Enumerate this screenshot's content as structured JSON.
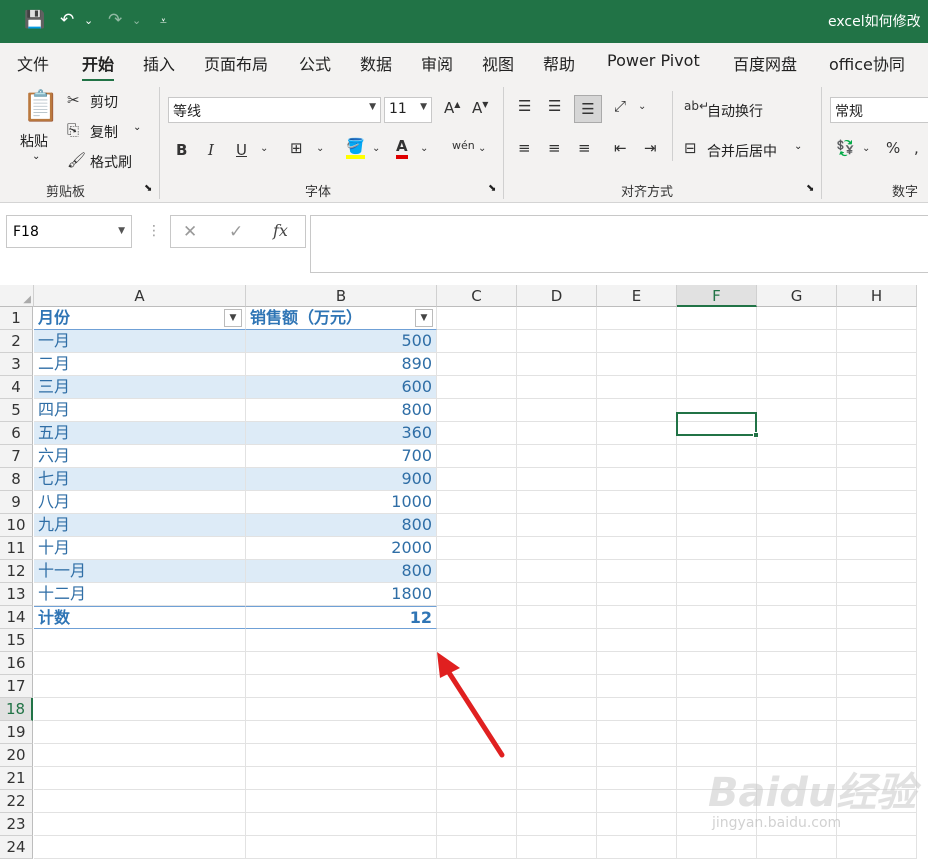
{
  "titlebar": {
    "title": "excel如何修改"
  },
  "tabs": [
    "文件",
    "开始",
    "插入",
    "页面布局",
    "公式",
    "数据",
    "审阅",
    "视图",
    "帮助",
    "Power Pivot",
    "百度网盘",
    "office协同"
  ],
  "ribbon": {
    "paste": "粘贴",
    "cut": "剪切",
    "copy": "复制",
    "format_painter": "格式刷",
    "clipboard_group": "剪贴板",
    "font_name": "等线",
    "font_size": "11",
    "font_group": "字体",
    "wrap_text": "自动换行",
    "merge_center": "合并后居中",
    "align_group": "对齐方式",
    "number_format": "常规",
    "number_group": "数字",
    "bold": "B",
    "italic": "I",
    "underline": "U"
  },
  "formula_bar": {
    "name_box": "F18",
    "fx": "fx",
    "value": ""
  },
  "columns": [
    "A",
    "B",
    "C",
    "D",
    "E",
    "F",
    "G",
    "H"
  ],
  "selected_column": "F",
  "selected_row": 18,
  "rows": [
    "1",
    "2",
    "3",
    "4",
    "5",
    "6",
    "7",
    "8",
    "9",
    "10",
    "11",
    "12",
    "13",
    "14",
    "15",
    "16",
    "17",
    "18",
    "19",
    "20",
    "21",
    "22",
    "23",
    "24"
  ],
  "table": {
    "header": {
      "month": "月份",
      "sales": "销售额（万元）"
    },
    "rows": [
      {
        "month": "一月",
        "sales": "500"
      },
      {
        "month": "二月",
        "sales": "890"
      },
      {
        "month": "三月",
        "sales": "600"
      },
      {
        "month": "四月",
        "sales": "800"
      },
      {
        "month": "五月",
        "sales": "360"
      },
      {
        "month": "六月",
        "sales": "700"
      },
      {
        "month": "七月",
        "sales": "900"
      },
      {
        "month": "八月",
        "sales": "1000"
      },
      {
        "month": "九月",
        "sales": "800"
      },
      {
        "month": "十月",
        "sales": "2000"
      },
      {
        "month": "十一月",
        "sales": "800"
      },
      {
        "month": "十二月",
        "sales": "1800"
      }
    ],
    "total": {
      "label": "计数",
      "value": "12"
    }
  },
  "watermark": {
    "brand": "Baidu经验",
    "url": "jingyan.baidu.com"
  },
  "colors": {
    "accent": "#217346",
    "table_band": "#ddebf7",
    "table_text": "#2f75b5",
    "arrow": "#e02020"
  }
}
